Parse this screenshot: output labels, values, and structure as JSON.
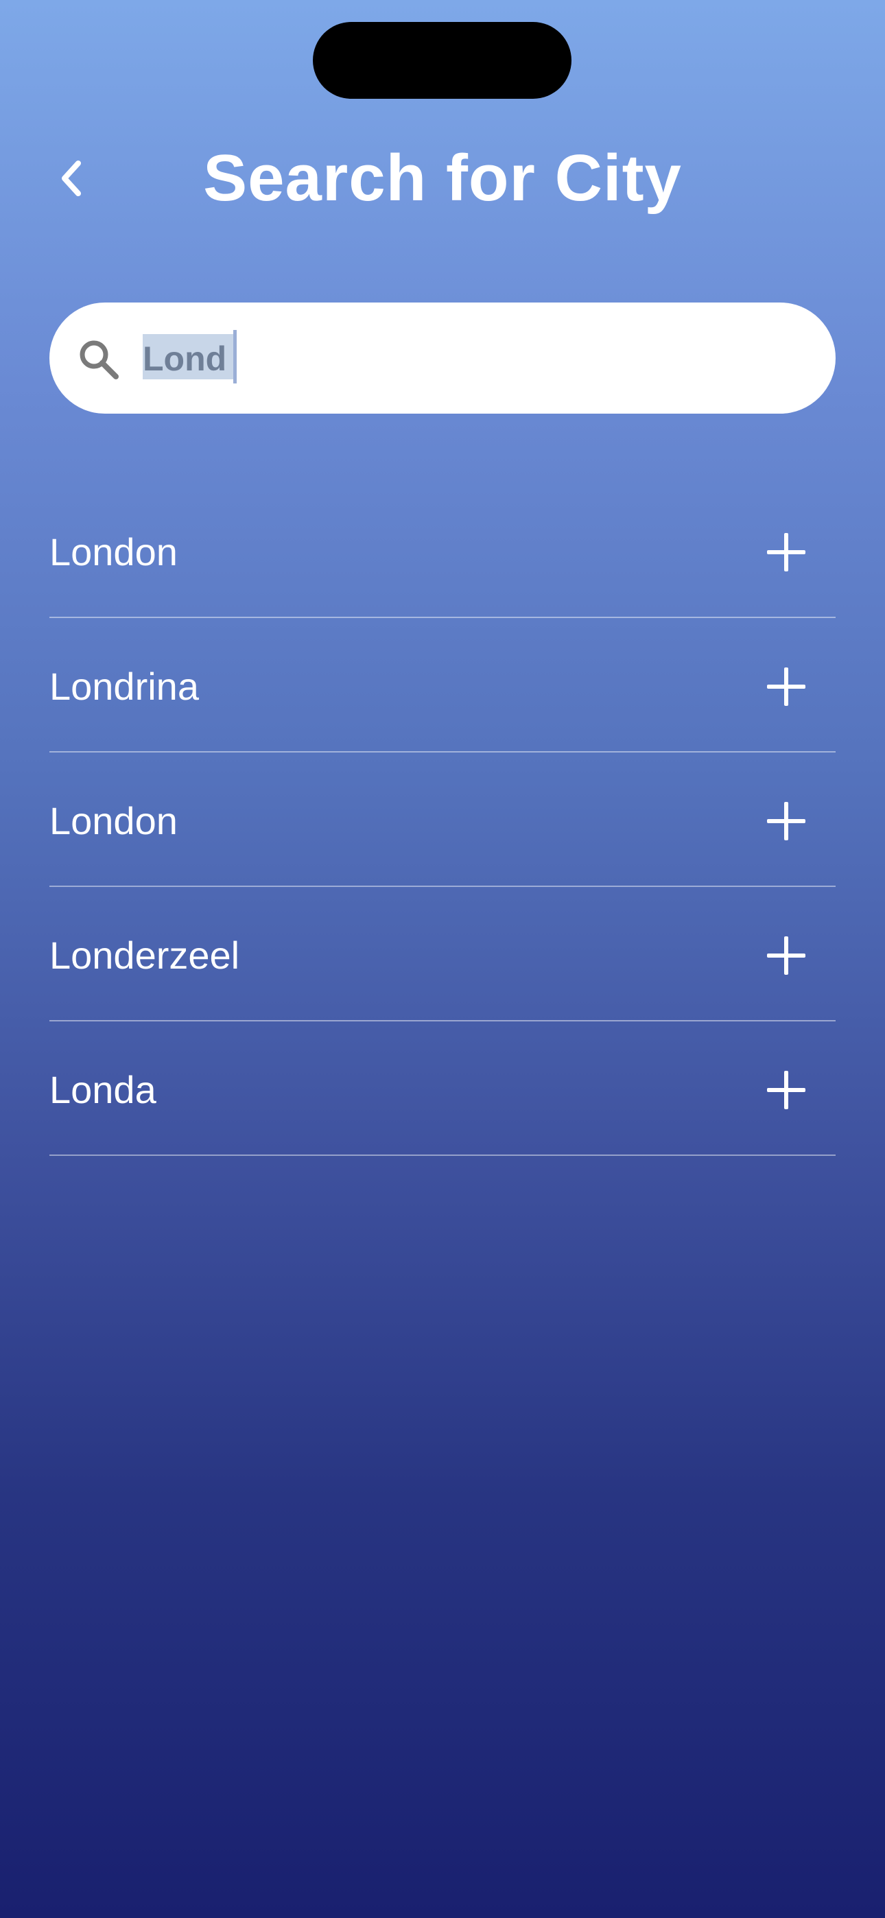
{
  "header": {
    "title": "Search for City",
    "back_icon": "chevron-left-icon"
  },
  "search": {
    "value": "Lond",
    "icon": "search-icon"
  },
  "results": [
    {
      "label": "London",
      "action_icon": "plus-icon"
    },
    {
      "label": "Londrina",
      "action_icon": "plus-icon"
    },
    {
      "label": "London",
      "action_icon": "plus-icon"
    },
    {
      "label": "Londerzeel",
      "action_icon": "plus-icon"
    },
    {
      "label": "Londa",
      "action_icon": "plus-icon"
    }
  ]
}
